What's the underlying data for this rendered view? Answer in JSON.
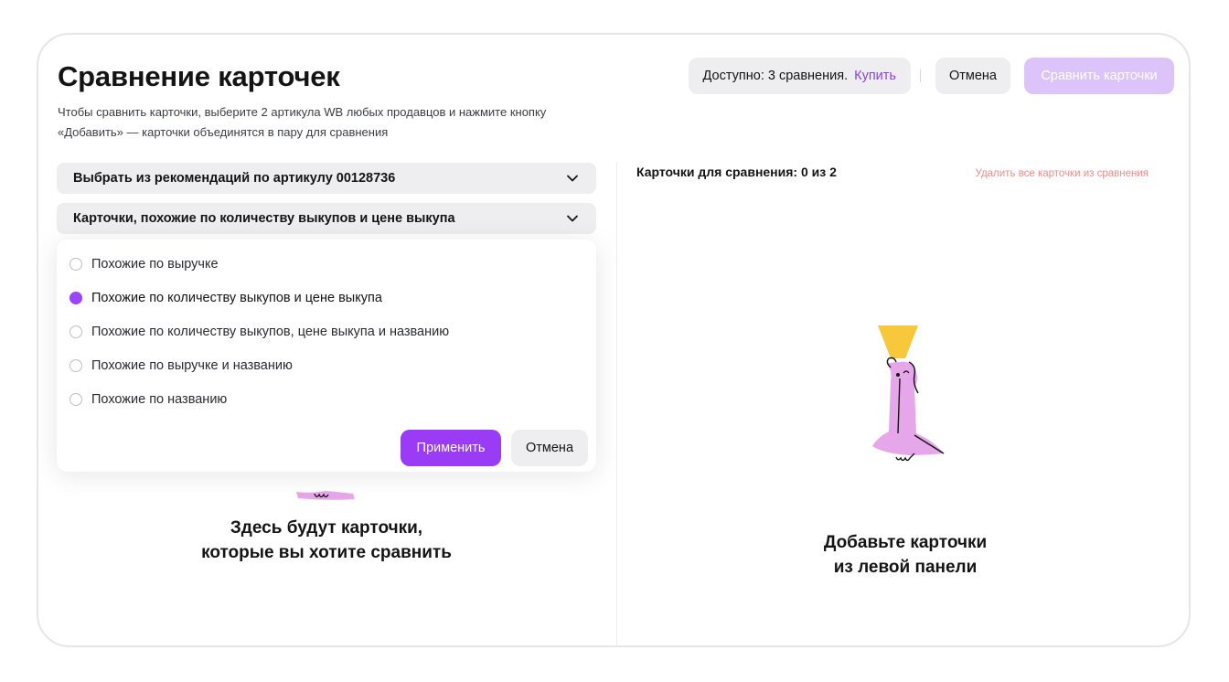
{
  "header": {
    "title": "Сравнение карточек",
    "subtitle_line1": "Чтобы сравнить карточки, выберите 2 артикула WB любых продавцов и нажмите кнопку",
    "subtitle_line2": "«Добавить» — карточки объединятся в пару для сравнения",
    "available_label": "Доступно: 3 сравнения.",
    "buy_label": "Купить",
    "cancel_label": "Отмена",
    "compare_label": "Сравнить карточки"
  },
  "left": {
    "select_recommendations": "Выбрать из рекомендаций по артикулу 00128736",
    "select_similarity": "Карточки, похожие по количеству выкупов и цене выкупа",
    "options": [
      {
        "label": "Похожие по выручке",
        "checked": false
      },
      {
        "label": "Похожие по количеству выкупов и цене выкупа",
        "checked": true
      },
      {
        "label": "Похожие по количеству выкупов, цене выкупа и названию",
        "checked": false
      },
      {
        "label": "Похожие по выручке и названию",
        "checked": false
      },
      {
        "label": "Похожие по названию",
        "checked": false
      }
    ],
    "apply_label": "Применить",
    "cancel_label": "Отмена",
    "empty_line1": "Здесь будут карточки,",
    "empty_line2": "которые вы хотите сравнить"
  },
  "right": {
    "cards_label": "Карточки для сравнения: 0 из 2",
    "remove_all_label": "Удалить все карточки из сравнения",
    "empty_line1": "Добавьте карточки",
    "empty_line2": "из левой панели"
  },
  "colors": {
    "accent": "#9a3cf6",
    "accent_disabled": "#dcc4fb",
    "danger_link": "#f28a8a",
    "figure_pink": "#e6a7ea",
    "figure_yellow": "#f7c83c"
  }
}
